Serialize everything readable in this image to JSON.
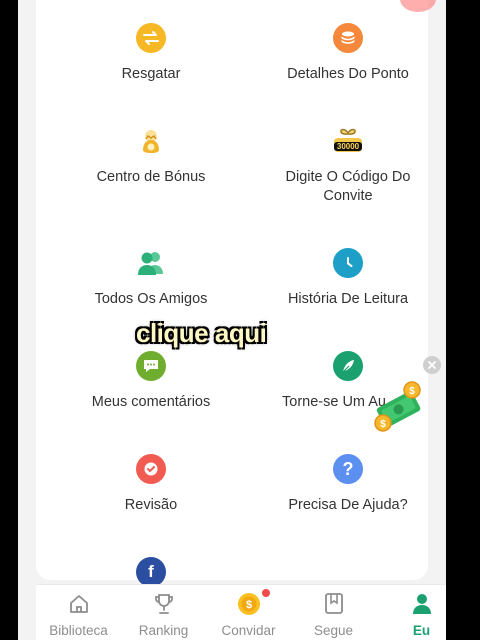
{
  "menu": {
    "items": [
      {
        "label": "Resgatar",
        "icon": "swap-icon",
        "color": "#f7b825"
      },
      {
        "label": "Detalhes Do Ponto",
        "icon": "coin-stack-icon",
        "color": "#f5883a"
      },
      {
        "label": "Centro de Bónus",
        "icon": "gold-sack-icon",
        "color": "#f2b42c"
      },
      {
        "label": "Digite O Código Do Convite",
        "icon": "gift-30000-icon",
        "color": "#e0a624"
      },
      {
        "label": "Todos Os Amigos",
        "icon": "friends-icon",
        "color": "#2bb07a"
      },
      {
        "label": "História De Leitura",
        "icon": "clock-icon",
        "color": "#1d9fc7"
      },
      {
        "label": "Meus comentários",
        "icon": "comment-icon",
        "color": "#6fad2f"
      },
      {
        "label": "Torne-se Um Au",
        "icon": "quill-icon",
        "color": "#1aa16f"
      },
      {
        "label": "Revisão",
        "icon": "check-badge-icon",
        "color": "#f15b52"
      },
      {
        "label": "Precisa De Ajuda?",
        "icon": "help-icon",
        "color": "#5b8ff0"
      },
      {
        "label": "",
        "icon": "facebook-icon",
        "color": "#2b4ea1"
      }
    ],
    "gift_number": "30000"
  },
  "overlay": {
    "caption": "clique aqui"
  },
  "nav": {
    "items": [
      {
        "label": "Biblioteca",
        "icon": "home-icon"
      },
      {
        "label": "Ranking",
        "icon": "trophy-icon"
      },
      {
        "label": "Convidar",
        "icon": "coin-icon"
      },
      {
        "label": "Segue",
        "icon": "bookmark-icon"
      },
      {
        "label": "Eu",
        "icon": "user-icon"
      }
    ],
    "active": "Eu",
    "active_color": "#1aa16f"
  }
}
